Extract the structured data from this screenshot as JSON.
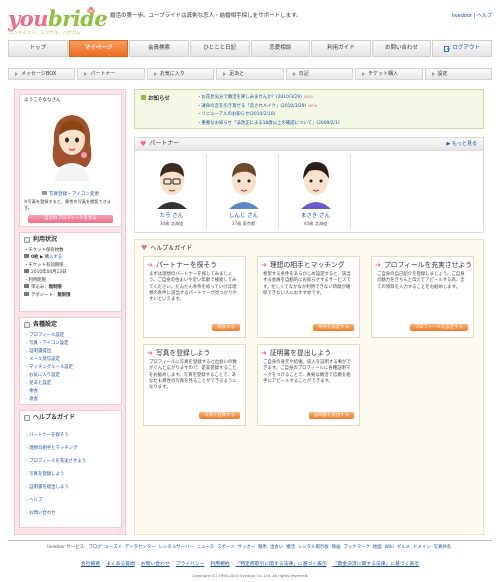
{
  "header": {
    "logo_pre": "you",
    "logo_post": "bride",
    "logo_sub": "ウンメイヒト、ミツケル、ハグクム",
    "tagline": "婚活の第一歩。ユーブライドは真剣な恋人・結婚相手探しをサポートします。",
    "links": [
      "livedoor",
      "ヘルプ"
    ]
  },
  "nav": {
    "tabs": [
      "トップ",
      "マイページ",
      "会員検索",
      "ひとこと日記",
      "恋愛相談",
      "利用ガイド",
      "お問い合わせ"
    ],
    "logout": "ログアウト",
    "active_index": 1
  },
  "subnav": [
    "メッセージBOX",
    "パートナー",
    "お気に入り",
    "足あと",
    "日記",
    "チケット購入",
    "設定"
  ],
  "sidebar": {
    "welcome": "ようこそ",
    "welcome_user": "ななさん",
    "photo_link": "写真登録・アイコン変更",
    "photo_note": "※写真を登録すると、異性の写真を閲覧できます。",
    "profile_btn": "自分のプロフィールを見る",
    "status": {
      "title": "利用状況",
      "ticket_label": "・チケット保有枚数",
      "ticket_count": "0枚",
      "ticket_buy": "購入する",
      "ticket_expiry_label": "・チケット有効期限",
      "ticket_expiry": "2010年04月13日",
      "period_label": "・利用期限",
      "single": "単込み",
      "single_val": "無制限",
      "deposit": "デポジート",
      "deposit_val": "無制限"
    },
    "settings": {
      "title": "各種設定",
      "items": [
        "プロフィール設定",
        "写真・アイコン設定",
        "証明書提出",
        "メール受信設定",
        "マッチングルール設定",
        "お気に入り設定",
        "足あと設定",
        "休会",
        "退会"
      ]
    },
    "help": {
      "title": "ヘルプ＆ガイド",
      "items": [
        "パートナーを探そう",
        "理想の相手とマッチング",
        "プロフィールを充実させよう",
        "写真を登録しよう",
        "証明書を提出しよう",
        "ヘルプ",
        "お問い合わせ"
      ]
    }
  },
  "news": {
    "label": "お知らせ",
    "items": [
      "・お花見気分で婚活を楽しみませんか？(2010/3/29)",
      "・運命の恋を引き寄せる「恋されメイク」(2010/3/29)",
      "・リニューアルのお知らせ(2010/2/10)",
      "・重要なお知らせ「法改正による18歳以上の確認について」(2009/2/1)"
    ],
    "new_tag": "NEW"
  },
  "partner": {
    "title": "パートナー",
    "more": "もっと見る",
    "cards": [
      {
        "name": "たろ さん",
        "info": "30歳 北海道"
      },
      {
        "name": "しんじ さん",
        "info": "37歳 東京都"
      },
      {
        "name": "まさき さん",
        "info": "40歳 北海道"
      }
    ]
  },
  "guide": {
    "title": "ヘルプ＆ガイド",
    "cards": [
      {
        "title": "パートナーを探そう",
        "body": "まずは理想のパートナーを探してみましょう。ご自身の住まいや近い年齢で検索してみてください。だんだん条件を絞っていけば理想の条件に該当するパートナーが見つかりやすいといえます。",
        "btn": "検索する"
      },
      {
        "title": "理想の相手とマッチング",
        "body": "希望する条件をあらかじめ設定すると、該当する会員を自動的にお知らせするサービスです。忙しくてなかなか利用できない時間が確保できない人におすすめです。",
        "btn": "条件を設定する"
      },
      {
        "title": "プロフィールを充実させよう",
        "body": "ご自身の自己紹介を登録しましょう。ご自身の魅力をきちんと伝えてアピールする為、全ての項目を入力することをお勧めします。",
        "btn": "プロフィールを設定する"
      },
      {
        "title": "写真を登録しよう",
        "body": "プロフィールに写真を登録すると出会いの数がぐんと広がりますので、是非登録することをお勧めします。写真を登録することで、あなたも異性の写真を見ることができるようになります。",
        "btn": "写真を登録する"
      },
      {
        "title": "証明書を提出しよう",
        "body": "ご自身の身元や結婚、収入を証明する事ができます。ご自身のプロフィールに各種証明マークをつけることで、真剣な婚活で信頼を相手にアピールすることができます。",
        "btn": "証明書を提出する"
      }
    ]
  },
  "footer": {
    "services_label": "livedoor サービス:",
    "services": [
      "ブログ",
      "ユーズド",
      "データセンター",
      "レンタルサーバー",
      "ニュース",
      "スポーツ",
      "サッカー",
      "競馬",
      "出会い",
      "婚活",
      "レンタル掲示板",
      "映画",
      "ブックマーク",
      "地図",
      "Wiki",
      "グルメ",
      "ドメイン",
      "写真共有"
    ],
    "links": [
      "会社概要",
      "よくある質問",
      "お問い合わせ",
      "プライバシー",
      "利用規約",
      "「特定商取引に関する法律」に基づく表示",
      "「資金決済に関する法律」に基づく表示"
    ],
    "copyright": "Copyright (C) 1995-2010 livedoor Co.,Ltd. All rights reserved."
  },
  "colors": {
    "brand_green": "#8ec13d",
    "brand_pink": "#ef6b86",
    "accent_orange": "#ee6a1f"
  }
}
